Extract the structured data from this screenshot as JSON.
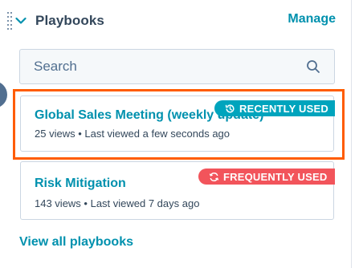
{
  "header": {
    "title": "Playbooks",
    "manage_label": "Manage"
  },
  "search": {
    "placeholder": "Search"
  },
  "playbooks": [
    {
      "title": "Global Sales Meeting (weekly update)",
      "meta": "25 views • Last viewed a few seconds ago",
      "badge": "RECENTLY USED",
      "badge_color": "#00a4bd",
      "badge_icon": "history-icon"
    },
    {
      "title": "Risk Mitigation",
      "meta": "143 views • Last viewed 7 days ago",
      "badge": "FREQUENTLY USED",
      "badge_color": "#f2545b",
      "badge_icon": "refresh-icon"
    }
  ],
  "footer": {
    "view_all_label": "View all playbooks"
  },
  "colors": {
    "accent": "#0091ae",
    "text": "#33475b",
    "highlight": "#ff5c00"
  }
}
